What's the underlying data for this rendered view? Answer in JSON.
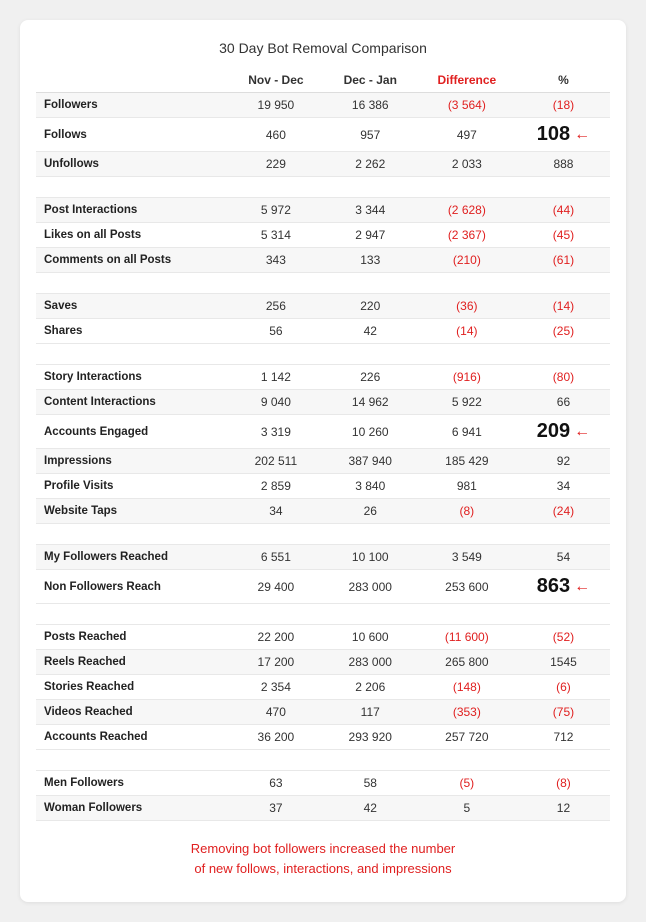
{
  "title": "30 Day Bot Removal Comparison",
  "columns": {
    "metric": "",
    "nov_dec": "Nov - Dec",
    "dec_jan": "Dec - Jan",
    "difference": "Difference",
    "percent": "%"
  },
  "rows": [
    {
      "label": "Followers",
      "nov_dec": "19 950",
      "dec_jan": "16 386",
      "diff": "(3 564)",
      "diff_red": true,
      "pct": "(18)",
      "pct_red": true,
      "highlight": false,
      "spacer_before": false
    },
    {
      "label": "Follows",
      "nov_dec": "460",
      "dec_jan": "957",
      "diff": "497",
      "diff_red": false,
      "pct": "108",
      "pct_red": false,
      "highlight": true,
      "spacer_before": false
    },
    {
      "label": "Unfollows",
      "nov_dec": "229",
      "dec_jan": "2 262",
      "diff": "2 033",
      "diff_red": false,
      "pct": "888",
      "pct_red": false,
      "highlight": false,
      "spacer_before": false
    },
    {
      "label": "_spacer1",
      "nov_dec": "",
      "dec_jan": "",
      "diff": "",
      "diff_red": false,
      "pct": "",
      "pct_red": false,
      "highlight": false,
      "spacer_before": false,
      "spacer": true
    },
    {
      "label": "Post Interactions",
      "nov_dec": "5 972",
      "dec_jan": "3 344",
      "diff": "(2 628)",
      "diff_red": true,
      "pct": "(44)",
      "pct_red": true,
      "highlight": false,
      "spacer_before": false
    },
    {
      "label": "Likes on all Posts",
      "nov_dec": "5 314",
      "dec_jan": "2 947",
      "diff": "(2 367)",
      "diff_red": true,
      "pct": "(45)",
      "pct_red": true,
      "highlight": false,
      "spacer_before": false
    },
    {
      "label": "Comments on all Posts",
      "nov_dec": "343",
      "dec_jan": "133",
      "diff": "(210)",
      "diff_red": true,
      "pct": "(61)",
      "pct_red": true,
      "highlight": false,
      "spacer_before": false
    },
    {
      "label": "_spacer2",
      "nov_dec": "",
      "dec_jan": "",
      "diff": "",
      "diff_red": false,
      "pct": "",
      "pct_red": false,
      "highlight": false,
      "spacer_before": false,
      "spacer": true
    },
    {
      "label": "Saves",
      "nov_dec": "256",
      "dec_jan": "220",
      "diff": "(36)",
      "diff_red": true,
      "pct": "(14)",
      "pct_red": true,
      "highlight": false,
      "spacer_before": false
    },
    {
      "label": "Shares",
      "nov_dec": "56",
      "dec_jan": "42",
      "diff": "(14)",
      "diff_red": true,
      "pct": "(25)",
      "pct_red": true,
      "highlight": false,
      "spacer_before": false
    },
    {
      "label": "_spacer3",
      "nov_dec": "",
      "dec_jan": "",
      "diff": "",
      "diff_red": false,
      "pct": "",
      "pct_red": false,
      "highlight": false,
      "spacer_before": false,
      "spacer": true
    },
    {
      "label": "Story Interactions",
      "nov_dec": "1 142",
      "dec_jan": "226",
      "diff": "(916)",
      "diff_red": true,
      "pct": "(80)",
      "pct_red": true,
      "highlight": false,
      "spacer_before": false
    },
    {
      "label": "Content Interactions",
      "nov_dec": "9 040",
      "dec_jan": "14 962",
      "diff": "5 922",
      "diff_red": false,
      "pct": "66",
      "pct_red": false,
      "highlight": false,
      "spacer_before": false
    },
    {
      "label": "Accounts Engaged",
      "nov_dec": "3 319",
      "dec_jan": "10 260",
      "diff": "6 941",
      "diff_red": false,
      "pct": "209",
      "pct_red": false,
      "highlight": true,
      "spacer_before": false
    },
    {
      "label": "Impressions",
      "nov_dec": "202 511",
      "dec_jan": "387 940",
      "diff": "185 429",
      "diff_red": false,
      "pct": "92",
      "pct_red": false,
      "highlight": false,
      "spacer_before": false
    },
    {
      "label": "Profile Visits",
      "nov_dec": "2 859",
      "dec_jan": "3 840",
      "diff": "981",
      "diff_red": false,
      "pct": "34",
      "pct_red": false,
      "highlight": false,
      "spacer_before": false
    },
    {
      "label": "Website Taps",
      "nov_dec": "34",
      "dec_jan": "26",
      "diff": "(8)",
      "diff_red": true,
      "pct": "(24)",
      "pct_red": true,
      "highlight": false,
      "spacer_before": false
    },
    {
      "label": "_spacer4",
      "nov_dec": "",
      "dec_jan": "",
      "diff": "",
      "diff_red": false,
      "pct": "",
      "pct_red": false,
      "highlight": false,
      "spacer_before": false,
      "spacer": true
    },
    {
      "label": "My Followers Reached",
      "nov_dec": "6 551",
      "dec_jan": "10 100",
      "diff": "3 549",
      "diff_red": false,
      "pct": "54",
      "pct_red": false,
      "highlight": false,
      "spacer_before": false
    },
    {
      "label": "Non Followers Reach",
      "nov_dec": "29 400",
      "dec_jan": "283 000",
      "diff": "253 600",
      "diff_red": false,
      "pct": "863",
      "pct_red": false,
      "highlight": true,
      "spacer_before": false
    },
    {
      "label": "_spacer5",
      "nov_dec": "",
      "dec_jan": "",
      "diff": "",
      "diff_red": false,
      "pct": "",
      "pct_red": false,
      "highlight": false,
      "spacer_before": false,
      "spacer": true
    },
    {
      "label": "Posts Reached",
      "nov_dec": "22 200",
      "dec_jan": "10 600",
      "diff": "(11 600)",
      "diff_red": true,
      "pct": "(52)",
      "pct_red": true,
      "highlight": false,
      "spacer_before": false
    },
    {
      "label": "Reels Reached",
      "nov_dec": "17 200",
      "dec_jan": "283 000",
      "diff": "265 800",
      "diff_red": false,
      "pct": "1545",
      "pct_red": false,
      "highlight": false,
      "spacer_before": false
    },
    {
      "label": "Stories Reached",
      "nov_dec": "2 354",
      "dec_jan": "2 206",
      "diff": "(148)",
      "diff_red": true,
      "pct": "(6)",
      "pct_red": true,
      "highlight": false,
      "spacer_before": false
    },
    {
      "label": "Videos Reached",
      "nov_dec": "470",
      "dec_jan": "117",
      "diff": "(353)",
      "diff_red": true,
      "pct": "(75)",
      "pct_red": true,
      "highlight": false,
      "spacer_before": false
    },
    {
      "label": "Accounts Reached",
      "nov_dec": "36 200",
      "dec_jan": "293 920",
      "diff": "257 720",
      "diff_red": false,
      "pct": "712",
      "pct_red": false,
      "highlight": false,
      "spacer_before": false
    },
    {
      "label": "_spacer6",
      "nov_dec": "",
      "dec_jan": "",
      "diff": "",
      "diff_red": false,
      "pct": "",
      "pct_red": false,
      "highlight": false,
      "spacer_before": false,
      "spacer": true
    },
    {
      "label": "Men Followers",
      "nov_dec": "63",
      "dec_jan": "58",
      "diff": "(5)",
      "diff_red": true,
      "pct": "(8)",
      "pct_red": true,
      "highlight": false,
      "spacer_before": false
    },
    {
      "label": "Woman Followers",
      "nov_dec": "37",
      "dec_jan": "42",
      "diff": "5",
      "diff_red": false,
      "pct": "12",
      "pct_red": false,
      "highlight": false,
      "spacer_before": false
    }
  ],
  "footer": "Removing bot followers increased the number\nof new follows, interactions, and impressions"
}
